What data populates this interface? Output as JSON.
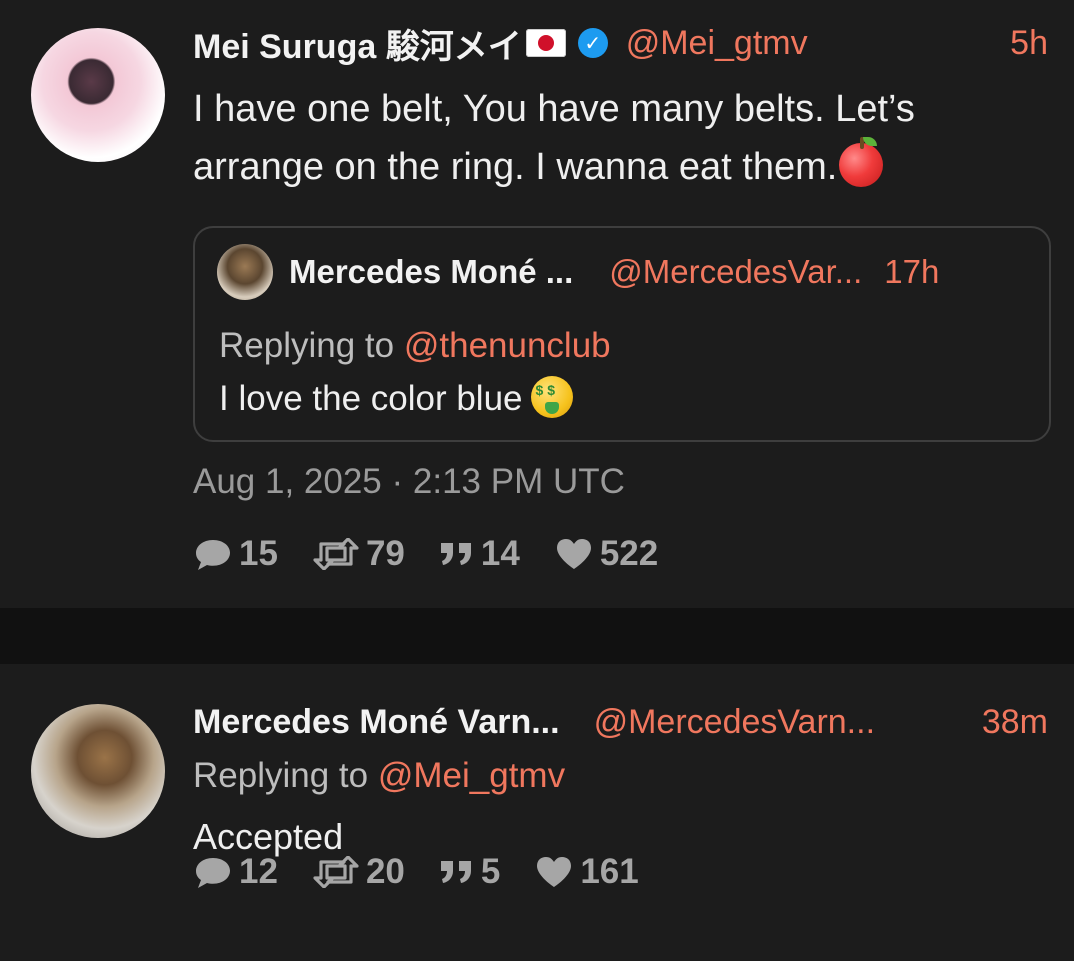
{
  "tweet1": {
    "author_name": "Mei Suruga 駿河メイ",
    "handle": "@Mei_gtmv",
    "time": "5h",
    "text": "I have one belt, You have many belts. Let’s arrange on the ring. I wanna eat them.",
    "timestamp": "Aug 1, 2025 · 2:13 PM UTC",
    "stats": {
      "replies": "15",
      "retweets": "79",
      "quotes": "14",
      "likes": "522"
    },
    "quoted": {
      "author_name": "Mercedes Moné ...",
      "handle": "@MercedesVar...",
      "time": "17h",
      "replying_label": "Replying to",
      "replying_to": "@thenunclub",
      "text": "I love the color blue"
    }
  },
  "tweet2": {
    "author_name": "Mercedes Moné Varn...",
    "handle": "@MercedesVarn...",
    "time": "38m",
    "replying_label": "Replying to",
    "replying_to": "@Mei_gtmv",
    "text": "Accepted",
    "stats": {
      "replies": "12",
      "retweets": "20",
      "quotes": "5",
      "likes": "161"
    }
  },
  "icons": {
    "verified": "✓"
  },
  "colors": {
    "background": "#1c1c1c",
    "divider": "#111111",
    "accent": "#f0775e",
    "verified": "#1d9bf0"
  }
}
